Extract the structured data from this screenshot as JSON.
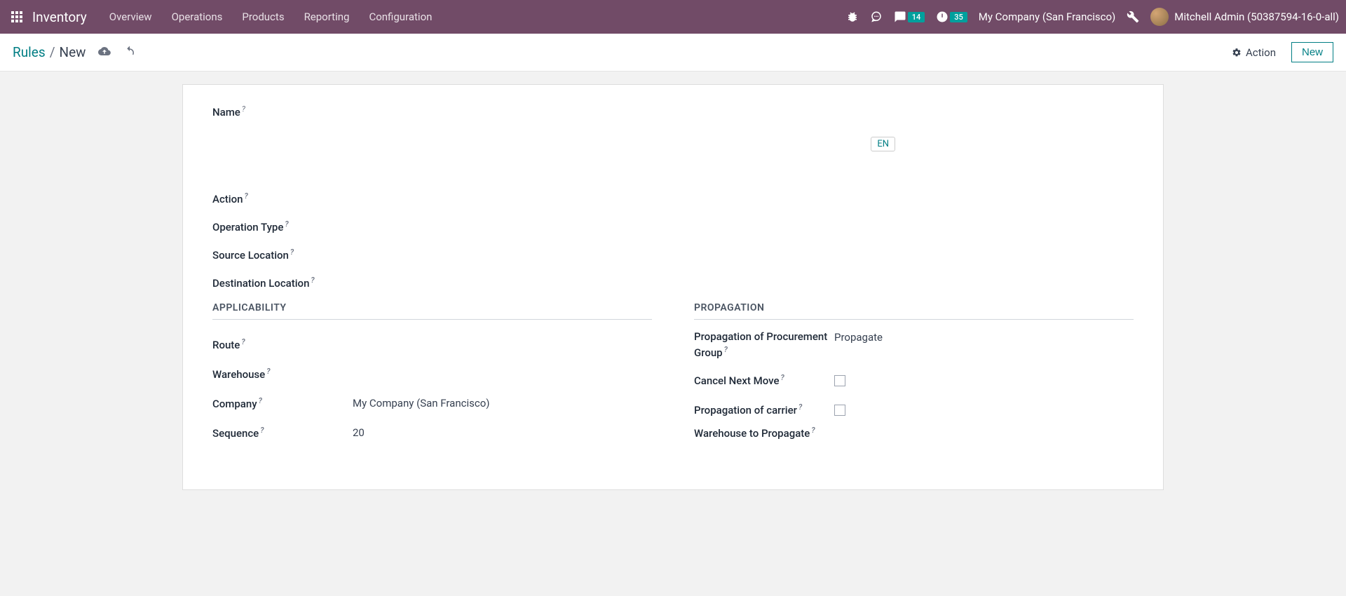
{
  "topbar": {
    "brand": "Inventory",
    "nav": [
      "Overview",
      "Operations",
      "Products",
      "Reporting",
      "Configuration"
    ],
    "msg_badge": "14",
    "clock_badge": "35",
    "company": "My Company (San Francisco)",
    "user": "Mitchell Admin (50387594-16-0-all)"
  },
  "breadcrumb": {
    "root": "Rules",
    "current": "New",
    "action_label": "Action",
    "new_label": "New"
  },
  "form": {
    "labels": {
      "name": "Name",
      "action": "Action",
      "operation_type": "Operation Type",
      "source_location": "Source Location",
      "destination_location": "Destination Location",
      "applicability": "APPLICABILITY",
      "route": "Route",
      "warehouse": "Warehouse",
      "company": "Company",
      "sequence": "Sequence",
      "propagation": "PROPAGATION",
      "propagation_group": "Propagation of Procurement Group",
      "cancel_next_move": "Cancel Next Move",
      "propagation_carrier": "Propagation of carrier",
      "warehouse_propagate": "Warehouse to Propagate"
    },
    "values": {
      "company": "My Company (San Francisco)",
      "sequence": "20",
      "propagation_group": "Propagate",
      "lang": "EN"
    }
  }
}
